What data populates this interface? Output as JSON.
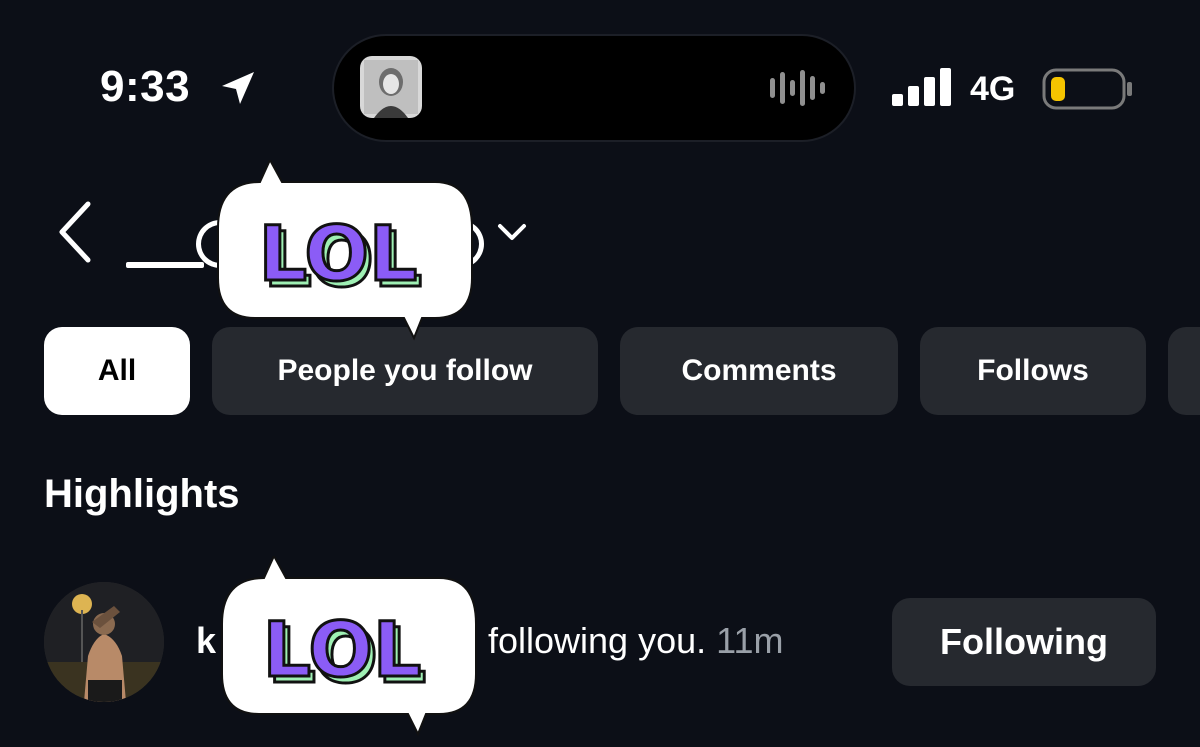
{
  "status_bar": {
    "time": "9:33",
    "network": "4G"
  },
  "header": {
    "back_icon": "chevron-left-icon",
    "dropdown_icon": "chevron-down-icon"
  },
  "filters": [
    {
      "label": "All",
      "active": true
    },
    {
      "label": "People you follow",
      "active": false
    },
    {
      "label": "Comments",
      "active": false
    },
    {
      "label": "Follows",
      "active": false
    }
  ],
  "section_title": "Highlights",
  "notification": {
    "name_initial": "k",
    "text": "following you.",
    "time": "11m",
    "button_label": "Following"
  },
  "stickers": [
    {
      "text": "LOL"
    },
    {
      "text": "LOL"
    }
  ],
  "colors": {
    "background": "#0c0f17",
    "chip": "#26292f",
    "battery_low": "#f5c400",
    "sticker_purple": "#8b5cf6",
    "sticker_green": "#9ff0b4"
  }
}
